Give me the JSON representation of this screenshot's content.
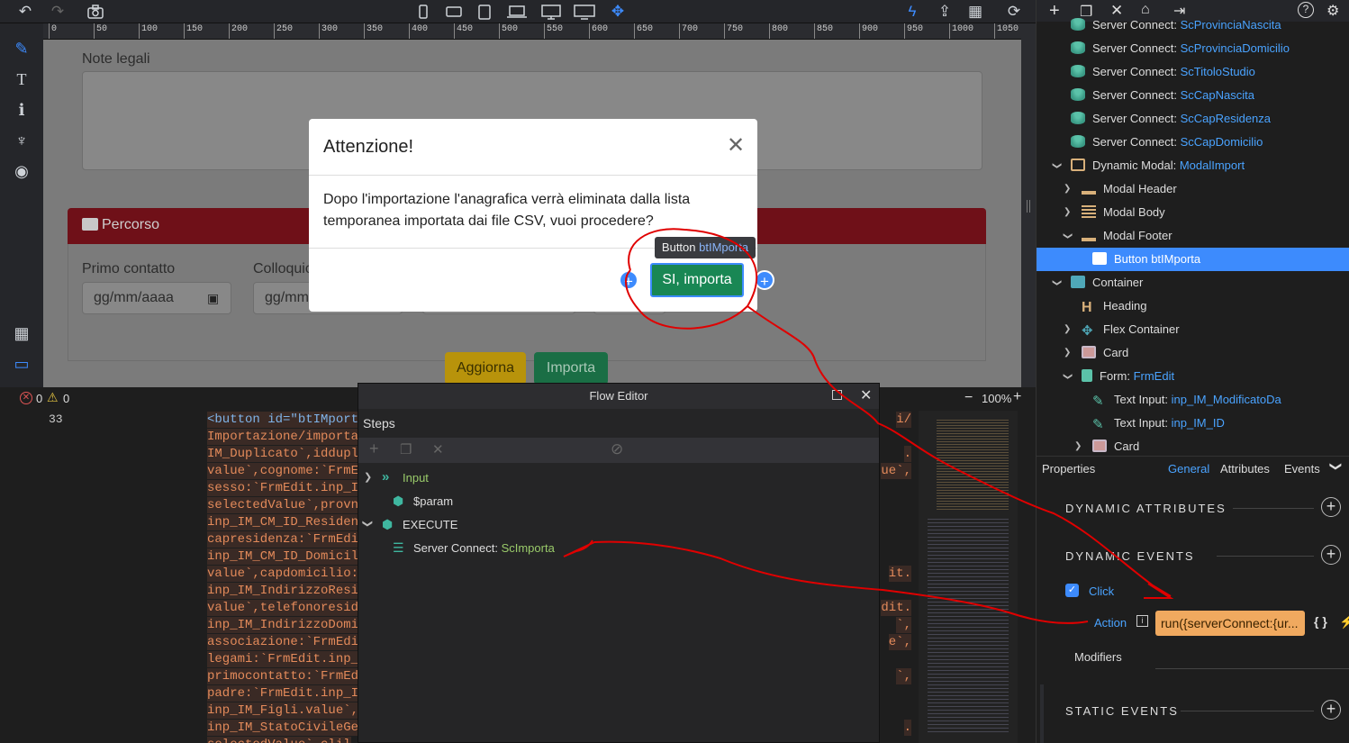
{
  "toolbar": {
    "zoom_label": "100%"
  },
  "ruler": {
    "ticks": [
      "0",
      "50",
      "100",
      "150",
      "200",
      "250",
      "300",
      "350",
      "400",
      "450",
      "500",
      "550",
      "600",
      "650",
      "700",
      "750",
      "800",
      "850",
      "900",
      "950",
      "1000",
      "1050"
    ]
  },
  "canvas": {
    "note_label": "Note legali",
    "percorso_title": "Percorso",
    "primo_contatto_label": "Primo contatto",
    "colloquio_label": "Colloquio",
    "date_placeholder": "gg/mm/aaaa",
    "date_placeholder_2": "gg/mm",
    "aggiorna_label": "Aggiorna",
    "importa_label": "Importa"
  },
  "modal": {
    "title": "Attenzione!",
    "body": "Dopo l'importazione l'anagrafica verrà eliminata dalla lista temporanea importata dai file CSV, vuoi procedere?",
    "confirm_label": "SI, importa",
    "tooltip_prefix": "Button",
    "tooltip_name": "btIMporta"
  },
  "status": {
    "errors": "0",
    "warnings": "0",
    "line_number": "33"
  },
  "code": {
    "lines": [
      "<button id=\"btIMport",
      "Importazione/importa",
      "IM_Duplicato`,iddupl",
      "value`,cognome:`FrmE",
      "sesso:`FrmEdit.inp_I",
      "selectedValue`,provn",
      "inp_IM_CM_ID_Residen",
      "capresidenza:`FrmEdi",
      "inp_IM_CM_ID_Domicil",
      "value`,capdomicilio:",
      "inp_IM_IndirizzoResi",
      "value`,telefonoresid",
      "inp_IM_IndirizzoDomi",
      "associazione:`FrmEdi",
      "legami:`FrmEdit.inp_",
      "primocontatto:`FrmEd",
      "padre:`FrmEdit.inp_I",
      "inp_IM_Figli.value`,",
      "inp_IM_StatoCivileGe",
      "selectedValue`,clil"
    ],
    "right_fragments": [
      "i/",
      ".",
      "ue`,",
      "it.",
      "dit.",
      "`,",
      "e`,",
      "`,",
      "."
    ]
  },
  "flow": {
    "title": "Flow Editor",
    "steps_label": "Steps",
    "input_label": "Input",
    "param_label": "$param",
    "execute_label": "EXECUTE",
    "sc_prefix": "Server Connect:",
    "sc_name": "ScImporta"
  },
  "tree": {
    "items": [
      {
        "prefix": "Server Connect:",
        "name": "ScProvinciaNascita"
      },
      {
        "prefix": "Server Connect:",
        "name": "ScProvinciaDomicilio"
      },
      {
        "prefix": "Server Connect:",
        "name": "ScTitoloStudio"
      },
      {
        "prefix": "Server Connect:",
        "name": "ScCapNascita"
      },
      {
        "prefix": "Server Connect:",
        "name": "ScCapResidenza"
      },
      {
        "prefix": "Server Connect:",
        "name": "ScCapDomicilio"
      },
      {
        "prefix": "Dynamic Modal:",
        "name": "ModalImport"
      },
      {
        "prefix": "Modal Header",
        "name": ""
      },
      {
        "prefix": "Modal Body",
        "name": ""
      },
      {
        "prefix": "Modal Footer",
        "name": ""
      },
      {
        "prefix": "Button btIMporta",
        "name": ""
      },
      {
        "prefix": "Container",
        "name": ""
      },
      {
        "prefix": "Heading",
        "name": ""
      },
      {
        "prefix": "Flex Container",
        "name": ""
      },
      {
        "prefix": "Card",
        "name": ""
      },
      {
        "prefix": "Form:",
        "name": "FrmEdit"
      },
      {
        "prefix": "Text Input:",
        "name": "inp_IM_ModificatoDa"
      },
      {
        "prefix": "Text Input:",
        "name": "inp_IM_ID"
      },
      {
        "prefix": "Card",
        "name": ""
      }
    ]
  },
  "props": {
    "title": "Properties",
    "tabs": [
      "General",
      "Attributes",
      "Events"
    ],
    "dynamic_attributes": "DYNAMIC ATTRIBUTES",
    "dynamic_events": "DYNAMIC EVENTS",
    "click_label": "Click",
    "action_label": "Action",
    "action_value": "run({serverConnect:{ur...",
    "modifiers_label": "Modifiers",
    "static_events": "STATIC EVENTS"
  },
  "colors": {
    "accent": "#3d8bfd",
    "danger": "#7a0f1f",
    "success": "#198754",
    "warning": "#c9a200",
    "annotation": "#e00000"
  }
}
